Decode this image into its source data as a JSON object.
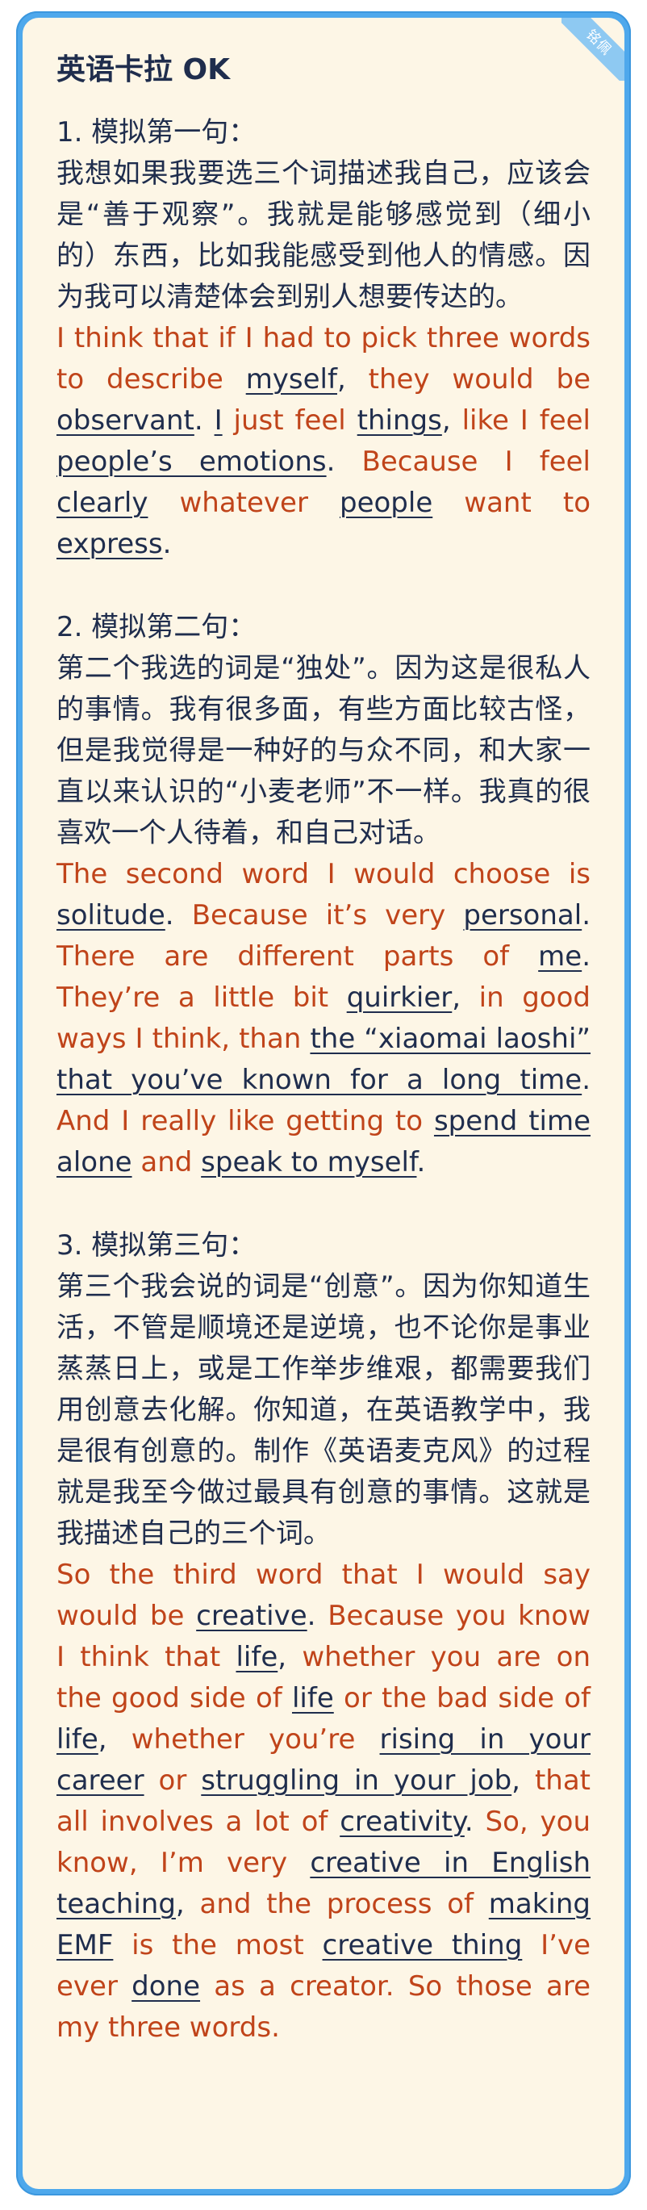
{
  "badge": "铭佩",
  "title": "英语卡拉 OK",
  "sections": [
    {
      "heading": "1. 模拟第一句：",
      "chinese": "我想如果我要选三个词描述我自己，应该会是“善于观察”。我就是能够感觉到（细小的）东西，比如我能感受到他人的情感。因为我可以清楚体会到别人想要传达的。",
      "english": [
        {
          "t": "I think that if I had to pick three words to describe "
        },
        {
          "t": "myself",
          "h": true
        },
        {
          "t": ",",
          "p": true
        },
        {
          "t": " they would be "
        },
        {
          "t": "observant",
          "h": true
        },
        {
          "t": ".",
          "p": true
        },
        {
          "t": " "
        },
        {
          "t": "I",
          "h": true
        },
        {
          "t": " just feel "
        },
        {
          "t": "things",
          "h": true
        },
        {
          "t": ",",
          "p": true
        },
        {
          "t": " like I feel "
        },
        {
          "t": "people’s emotions",
          "h": true
        },
        {
          "t": ".",
          "p": true
        },
        {
          "t": " Because I feel "
        },
        {
          "t": "clearly",
          "h": true
        },
        {
          "t": " whatever "
        },
        {
          "t": "people",
          "h": true
        },
        {
          "t": " want to "
        },
        {
          "t": "express",
          "h": true
        },
        {
          "t": ".",
          "p": true
        }
      ]
    },
    {
      "heading": "2. 模拟第二句：",
      "chinese": "第二个我选的词是“独处”。因为这是很私人的事情。我有很多面，有些方面比较古怪，但是我觉得是一种好的与众不同，和大家一直以来认识的“小麦老师”不一样。我真的很喜欢一个人待着，和自己对话。",
      "english": [
        {
          "t": "The second word I would choose is "
        },
        {
          "t": "solitude",
          "h": true
        },
        {
          "t": ".",
          "p": true
        },
        {
          "t": " Because it’s very "
        },
        {
          "t": "personal",
          "h": true
        },
        {
          "t": ".",
          "p": true
        },
        {
          "t": " There are different parts of "
        },
        {
          "t": "me",
          "h": true
        },
        {
          "t": ".",
          "p": true
        },
        {
          "t": " They’re a little bit "
        },
        {
          "t": "quirkier",
          "h": true
        },
        {
          "t": ",",
          "p": true
        },
        {
          "t": " in good ways I think, than "
        },
        {
          "t": "the “xiaomai laoshi” that you’ve known for a long time",
          "h": true
        },
        {
          "t": ".",
          "p": true
        },
        {
          "t": " And I really like getting to "
        },
        {
          "t": "spend time alone",
          "h": true
        },
        {
          "t": " and "
        },
        {
          "t": "speak to myself",
          "h": true
        },
        {
          "t": ".",
          "p": true
        }
      ]
    },
    {
      "heading": "3. 模拟第三句：",
      "chinese": "第三个我会说的词是“创意”。因为你知道生活，不管是顺境还是逆境，也不论你是事业蒸蒸日上，或是工作举步维艰，都需要我们用创意去化解。你知道，在英语教学中，我是很有创意的。制作《英语麦克风》的过程就是我至今做过最具有创意的事情。这就是我描述自己的三个词。",
      "english": [
        {
          "t": "So the third word that I would say would be "
        },
        {
          "t": "creative",
          "h": true
        },
        {
          "t": ".",
          "p": true
        },
        {
          "t": " Because you know I think that "
        },
        {
          "t": "life",
          "h": true
        },
        {
          "t": ",",
          "p": true
        },
        {
          "t": " whether you are on the good side of "
        },
        {
          "t": "life",
          "h": true
        },
        {
          "t": " or the bad side of "
        },
        {
          "t": "life",
          "h": true
        },
        {
          "t": ",",
          "p": true
        },
        {
          "t": " whether you’re "
        },
        {
          "t": "rising in your career",
          "h": true
        },
        {
          "t": " or "
        },
        {
          "t": "struggling in your job",
          "h": true
        },
        {
          "t": ",",
          "p": true
        },
        {
          "t": " that all involves a lot of "
        },
        {
          "t": "creativity",
          "h": true
        },
        {
          "t": ".",
          "p": true
        },
        {
          "t": " So, you know, I’m very "
        },
        {
          "t": "creative in English teaching",
          "h": true
        },
        {
          "t": ",",
          "p": true
        },
        {
          "t": " and the process of "
        },
        {
          "t": "making EMF",
          "h": true
        },
        {
          "t": " is the most "
        },
        {
          "t": "creative thing",
          "h": true
        },
        {
          "t": " I’ve ever "
        },
        {
          "t": "done",
          "h": true
        },
        {
          "t": " as a creator. So those are my three words."
        }
      ]
    }
  ]
}
